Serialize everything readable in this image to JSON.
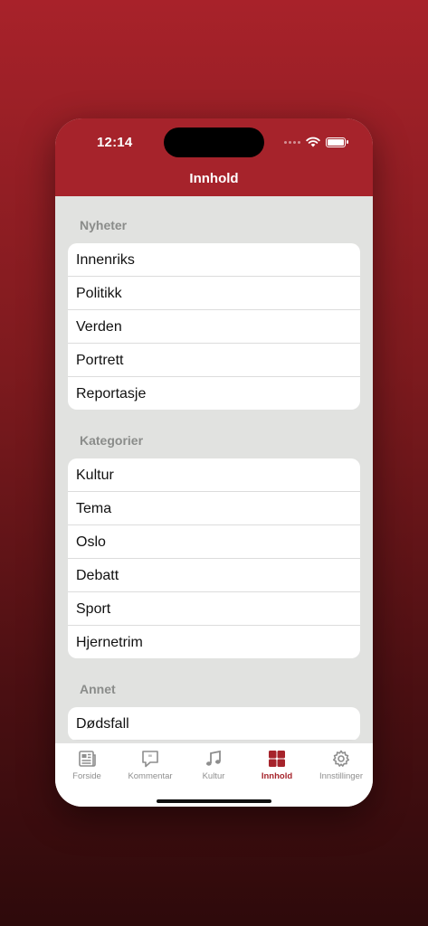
{
  "status_bar": {
    "time": "12:14"
  },
  "nav": {
    "title": "Innhold"
  },
  "sections": [
    {
      "title": "Nyheter",
      "items": [
        "Innenriks",
        "Politikk",
        "Verden",
        "Portrett",
        "Reportasje"
      ]
    },
    {
      "title": "Kategorier",
      "items": [
        "Kultur",
        "Tema",
        "Oslo",
        "Debatt",
        "Sport",
        "Hjernetrim"
      ]
    },
    {
      "title": "Annet",
      "items": [
        "Dødsfall"
      ]
    }
  ],
  "tabs": [
    {
      "label": "Forside",
      "icon": "newspaper-icon"
    },
    {
      "label": "Kommentar",
      "icon": "comment-icon"
    },
    {
      "label": "Kultur",
      "icon": "music-note-icon"
    },
    {
      "label": "Innhold",
      "icon": "grid-icon",
      "active": true
    },
    {
      "label": "Innstillinger",
      "icon": "gear-icon"
    }
  ],
  "colors": {
    "brand": "#a6232b",
    "background": "#e1e2e0",
    "inactive_tab": "#8e8e8e"
  }
}
